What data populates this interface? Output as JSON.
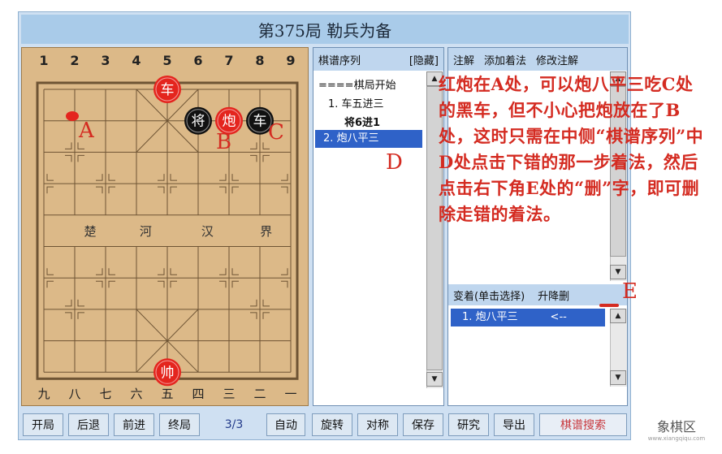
{
  "title": "第375局  勒兵为备",
  "board": {
    "top_files": [
      "1",
      "2",
      "3",
      "4",
      "5",
      "6",
      "7",
      "8",
      "9"
    ],
    "bottom_files": [
      "九",
      "八",
      "七",
      "六",
      "五",
      "四",
      "三",
      "二",
      "一"
    ],
    "river": [
      "楚",
      "河",
      "汉",
      "界"
    ],
    "pieces": [
      {
        "label": "车",
        "side": "red"
      },
      {
        "label": "将",
        "side": "black"
      },
      {
        "label": "炮",
        "side": "red"
      },
      {
        "label": "车",
        "side": "black"
      },
      {
        "label": "帅",
        "side": "red"
      }
    ],
    "marks": {
      "a": "A",
      "b": "B",
      "c": "C"
    }
  },
  "movelist": {
    "header_left": "棋谱序列",
    "header_right": "[隐藏]",
    "lines": [
      "====棋局开始",
      "1. 车五进三",
      "将6进1"
    ],
    "selected": "2. 炮八平三",
    "mark": "D"
  },
  "comment_panel": {
    "tabs": [
      "注解",
      "添加着法",
      "修改注解"
    ],
    "variation_header": "变着(单击选择)",
    "variation_actions": "升降删",
    "variation_item": "1. 炮八平三",
    "variation_arrow": "<--",
    "mark": "E"
  },
  "annotation": "红炮在A处，可以炮八平三吃C处的黑车，但不小心把炮放在了B处，这时只需在中侧“棋谱序列”中D处点击下错的那一步着法，然后点击右下角E处的“删”字，即可删除走错的着法。",
  "toolbar": {
    "buttons": [
      "开局",
      "后退",
      "前进",
      "终局"
    ],
    "move_count": "3/3",
    "buttons_right": [
      "自动",
      "旋转",
      "对称",
      "保存",
      "研究",
      "导出"
    ],
    "search": "棋谱搜索"
  },
  "watermark": "象棋区",
  "watermark_sub": "www.xiangqiqu.com",
  "colors": {
    "red_piece": "#e4251e",
    "black_piece": "#111111",
    "board": "#dcb988",
    "selection": "#2f62c8",
    "annotation": "#d42b21"
  }
}
